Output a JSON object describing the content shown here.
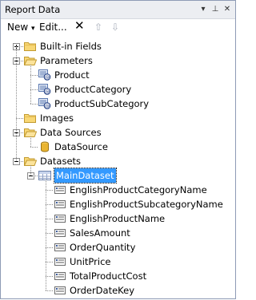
{
  "window": {
    "title": "Report Data",
    "buttons": {
      "dropdown": "▾",
      "pin": "⊥",
      "close": "✕"
    }
  },
  "toolbar": {
    "new_label": "New",
    "new_arrow": "▾",
    "edit_label": "Edit...",
    "delete_glyph": "✕",
    "up_glyph": "⇧",
    "down_glyph": "⇩"
  },
  "tree": {
    "builtin_fields": "Built-in Fields",
    "parameters": {
      "label": "Parameters",
      "items": [
        "Product",
        "ProductCategory",
        "ProductSubCategory"
      ]
    },
    "images": "Images",
    "data_sources": {
      "label": "Data Sources",
      "items": [
        "DataSource"
      ]
    },
    "datasets": {
      "label": "Datasets",
      "dataset": {
        "label": "MainDataset",
        "fields": [
          "EnglishProductCategoryName",
          "EnglishProductSubcategoryName",
          "EnglishProductName",
          "SalesAmount",
          "OrderQuantity",
          "UnitPrice",
          "TotalProductCost",
          "OrderDateKey"
        ]
      }
    }
  },
  "icons": {
    "folder": "folder-icon",
    "parameter": "parameter-icon",
    "datasource": "datasource-icon",
    "dataset": "dataset-icon",
    "field": "field-icon"
  },
  "colors": {
    "selection": "#3399ff",
    "folder_fill": "#f8d775",
    "folder_stroke": "#c29a30",
    "title_bg": "#eceef2"
  }
}
